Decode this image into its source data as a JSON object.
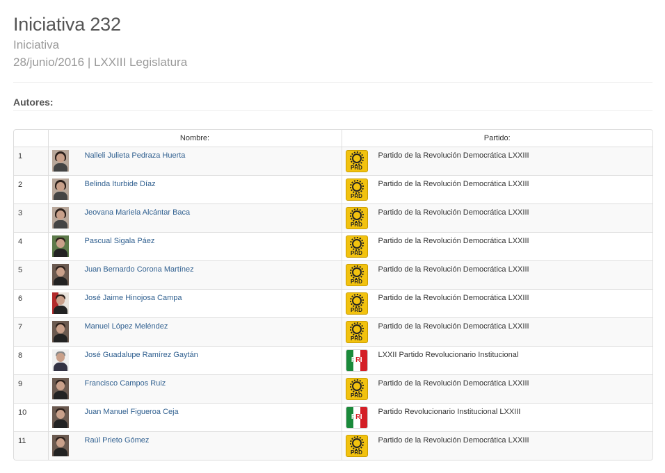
{
  "initiative": {
    "title": "Iniciativa 232",
    "type": "Iniciativa",
    "meta": "28/junio/2016 | LXXIII Legislatura"
  },
  "section_label": "Autores:",
  "table": {
    "headers": [
      "",
      "Nombre:",
      "Partido:"
    ],
    "rows": [
      {
        "num": "1",
        "name": "Nalleli Julieta Pedraza Huerta",
        "party": "Partido de la Revolución Democrática LXXIII",
        "logo": "PRD"
      },
      {
        "num": "2",
        "name": "Belinda Iturbide Díaz",
        "party": "Partido de la Revolución Democrática LXXIII",
        "logo": "PRD"
      },
      {
        "num": "3",
        "name": "Jeovana Mariela Alcántar Baca",
        "party": "Partido de la Revolución Democrática LXXIII",
        "logo": "PRD"
      },
      {
        "num": "4",
        "name": "Pascual Sigala Páez",
        "party": "Partido de la Revolución Democrática LXXIII",
        "logo": "PRD"
      },
      {
        "num": "5",
        "name": "Juan Bernardo Corona Martínez",
        "party": "Partido de la Revolución Democrática LXXIII",
        "logo": "PRD"
      },
      {
        "num": "6",
        "name": "José Jaime Hinojosa Campa",
        "party": "Partido de la Revolución Democrática LXXIII",
        "logo": "PRD"
      },
      {
        "num": "7",
        "name": "Manuel López Meléndez",
        "party": "Partido de la Revolución Democrática LXXIII",
        "logo": "PRD"
      },
      {
        "num": "8",
        "name": "José Guadalupe Ramírez Gaytán",
        "party": "LXXII Partido Revolucionario Institucional",
        "logo": "PRI"
      },
      {
        "num": "9",
        "name": "Francisco Campos Ruiz",
        "party": "Partido de la Revolución Democrática LXXIII",
        "logo": "PRD"
      },
      {
        "num": "10",
        "name": "Juan Manuel Figueroa Ceja",
        "party": "Partido Revolucionario Institucional LXXIII",
        "logo": "PRI"
      },
      {
        "num": "11",
        "name": "Raúl Prieto Gómez",
        "party": "Partido de la Revolución Democrática LXXIII",
        "logo": "PRD"
      }
    ]
  },
  "logos": {
    "PRD": {
      "text": "PRD",
      "color": "#f2c20f"
    },
    "PRI": {
      "text_left": "P",
      "text_mid": "R",
      "text_right": "I",
      "colors": [
        "#1a8a3a",
        "#ffffff",
        "#d41f26"
      ]
    }
  },
  "colors": {
    "link": "#2f5f8f",
    "title": "#555555",
    "muted": "#999999"
  }
}
